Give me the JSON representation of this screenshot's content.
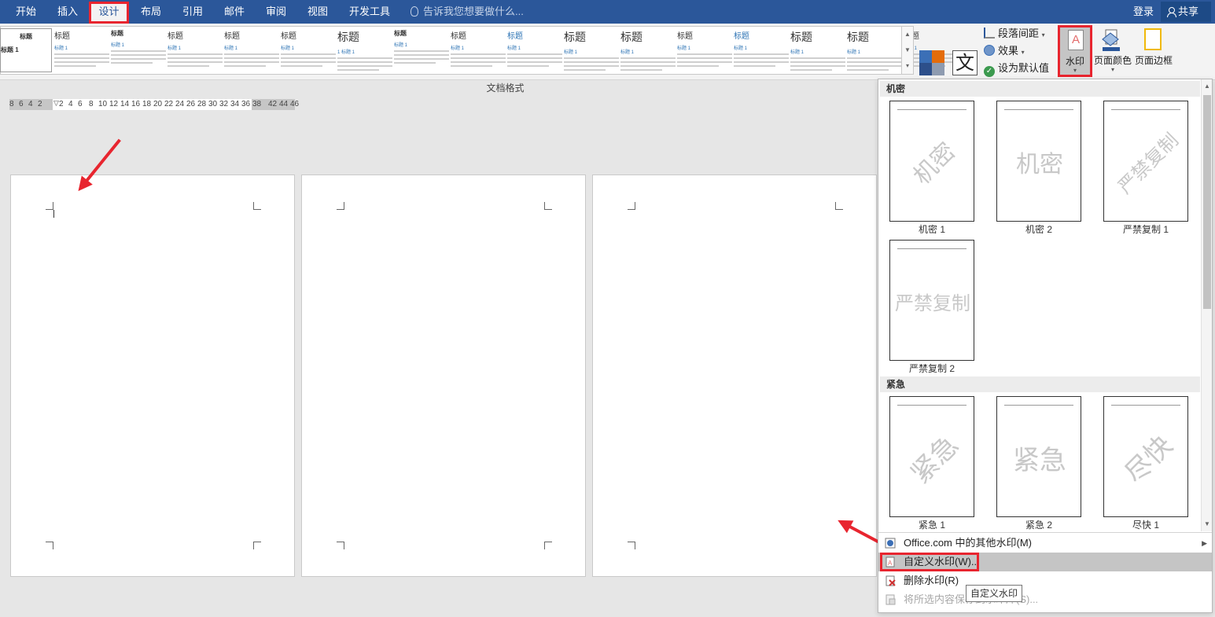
{
  "tabs": {
    "home": "开始",
    "insert": "插入",
    "design": "设计",
    "layout": "布局",
    "references": "引用",
    "mailings": "邮件",
    "review": "审阅",
    "view": "视图",
    "developer": "开发工具"
  },
  "search_placeholder": "告诉我您想要做什么...",
  "account": {
    "login": "登录",
    "share": "共享"
  },
  "ribbon": {
    "style_thumbs": [
      {
        "heading": "标题",
        "sub": "标题 1"
      },
      {
        "heading": "标题",
        "sub": "标题 1"
      },
      {
        "heading": "标题",
        "sub": "标题 1"
      },
      {
        "heading": "标题",
        "sub": "标题 1"
      },
      {
        "heading": "标题",
        "sub": "标题 1"
      },
      {
        "heading": "标题",
        "sub": "1 标题 1"
      },
      {
        "heading": "标题",
        "sub": "标题 1"
      },
      {
        "heading": "标题",
        "sub": "标题 1"
      },
      {
        "heading": "标题",
        "sub": "标题 1"
      },
      {
        "heading": "标题",
        "sub": "标题 1"
      },
      {
        "heading": "标题",
        "sub": "标题 1"
      },
      {
        "heading": "标题",
        "sub": "标题 1"
      },
      {
        "heading": "标题",
        "sub": "标题 1"
      },
      {
        "heading": "标题",
        "sub": "标题 1"
      },
      {
        "heading": "标题",
        "sub": "标题 1"
      },
      {
        "heading": "标题",
        "sub": "标题 1"
      }
    ],
    "first_thumb_heading": "标题",
    "first_thumb_sub": "标题 1",
    "colors": "颜色",
    "fonts": "字体",
    "font_glyph": "文",
    "paragraph_spacing": "段落间距",
    "effects": "效果",
    "set_default": "设为默认值",
    "watermark": "水印",
    "page_color": "页面颜色",
    "page_borders": "页面边框"
  },
  "document_formatting_label": "文档格式",
  "ruler_ticks": [
    "8",
    "6",
    "4",
    "2",
    "2",
    "4",
    "6",
    "8",
    "10",
    "12",
    "14",
    "16",
    "18",
    "20",
    "22",
    "24",
    "26",
    "28",
    "30",
    "32",
    "34",
    "36",
    "38",
    "42",
    "44",
    "46"
  ],
  "watermark_gallery": {
    "section_confidential": "机密",
    "section_urgent": "紧急",
    "items": [
      {
        "text": "机密",
        "caption": "机密 1",
        "style": "diag"
      },
      {
        "text": "机密",
        "caption": "机密 2",
        "style": "horiz"
      },
      {
        "text": "严禁复制",
        "caption": "严禁复制 1",
        "style": "diag"
      },
      {
        "text": "严禁复制",
        "caption": "严禁复制 2",
        "style": "horiz"
      },
      {
        "text": "紧急",
        "caption": "紧急 1",
        "style": "diag"
      },
      {
        "text": "紧急",
        "caption": "紧急 2",
        "style": "horiz"
      },
      {
        "text": "尽快",
        "caption": "尽快 1",
        "style": "diag"
      }
    ],
    "menu": {
      "more_online": "Office.com 中的其他水印(M)",
      "custom": "自定义水印(W)...",
      "remove": "删除水印(R)",
      "save_selection": "将所选内容保存到水印库(S)..."
    }
  },
  "tooltip": "自定义水印",
  "colors_palette": {
    "accent": "#2b579a",
    "highlight": "#e8252f"
  }
}
